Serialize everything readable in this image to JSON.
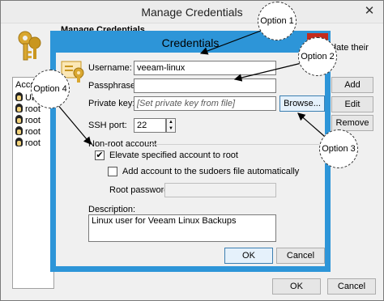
{
  "outer": {
    "title": "Manage Credentials",
    "header": "Manage Credentials",
    "desc_tail": "date their",
    "list_header": "Accou",
    "list_items": [
      "Ub",
      "root",
      "root",
      "root",
      "root"
    ],
    "buttons": {
      "add": "Add",
      "edit": "Edit",
      "remove": "Remove",
      "ok": "OK",
      "cancel": "Cancel"
    }
  },
  "dialog": {
    "title": "Credentials",
    "username_label": "Username:",
    "username_value": "veeam-linux",
    "passphrase_label": "Passphrase:",
    "private_key_label": "Private key:",
    "private_key_placeholder": "[Set private key from file]",
    "browse_label": "Browse...",
    "ssh_port_label": "SSH port:",
    "ssh_port_value": "22",
    "nonroot_group_label": "Non-root account",
    "elevate_label": "Elevate specified account to root",
    "elevate_checked": true,
    "sudoers_label": "Add account to the sudoers file automatically",
    "sudoers_checked": false,
    "root_password_label": "Root password:",
    "description_label": "Description:",
    "description_value": "Linux user for Veeam Linux Backups",
    "ok_label": "OK",
    "cancel_label": "Cancel"
  },
  "callouts": {
    "option1": "Option 1",
    "option2": "Option 2",
    "option3": "Option 3",
    "option4": "Option 4"
  },
  "colors": {
    "accent": "#2d95d8",
    "close": "#c42b1c"
  },
  "icons": [
    "key-icon",
    "penguin-icon",
    "close-icon",
    "spinner-up-icon",
    "spinner-down-icon",
    "checkmark-icon"
  ]
}
